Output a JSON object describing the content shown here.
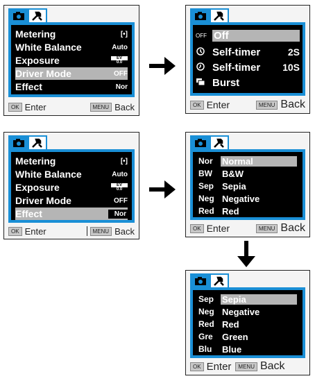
{
  "panel1": {
    "rows": [
      {
        "label": "Metering",
        "value": "[•]"
      },
      {
        "label": "White Balance",
        "value": "Auto"
      },
      {
        "label": "Exposure",
        "value_top": "EV",
        "value_bottom": "0.0"
      },
      {
        "label": "Driver Mode",
        "value": "OFF"
      },
      {
        "label": "Effect",
        "value": "Nor"
      }
    ],
    "footer": {
      "enter_key": "OK",
      "enter_label": "Enter",
      "back_key": "MENU",
      "back_label": "Back"
    }
  },
  "panel2": {
    "rows": [
      {
        "icon": "OFF",
        "label": "Off",
        "value": ""
      },
      {
        "icon": "timer-2s-icon",
        "label": "Self-timer",
        "value": "2S"
      },
      {
        "icon": "timer-10s-icon",
        "label": "Self-timer",
        "value": "10S"
      },
      {
        "icon": "burst-icon",
        "label": "Burst",
        "value": ""
      }
    ],
    "footer": {
      "enter_key": "OK",
      "enter_label": "Enter",
      "back_key": "MENU",
      "back_label": "Back"
    }
  },
  "panel3": {
    "rows": [
      {
        "label": "Metering",
        "value": "[•]"
      },
      {
        "label": "White Balance",
        "value": "Auto"
      },
      {
        "label": "Exposure",
        "value_top": "EV",
        "value_bottom": "0.0"
      },
      {
        "label": "Driver Mode",
        "value": "OFF"
      },
      {
        "label": "Effect",
        "value": "Nor"
      }
    ],
    "footer": {
      "enter_key": "OK",
      "enter_label": "Enter",
      "back_key": "MENU",
      "back_label": "Back"
    }
  },
  "panel4": {
    "rows": [
      {
        "code": "Nor",
        "name": "Normal"
      },
      {
        "code": "BW",
        "name": "B&W"
      },
      {
        "code": "Sep",
        "name": "Sepia"
      },
      {
        "code": "Neg",
        "name": "Negative"
      },
      {
        "code": "Red",
        "name": "Red"
      }
    ],
    "footer": {
      "enter_key": "OK",
      "enter_label": "Enter",
      "back_key": "MENU",
      "back_label": "Back"
    }
  },
  "panel5": {
    "rows": [
      {
        "code": "Sep",
        "name": "Sepia"
      },
      {
        "code": "Neg",
        "name": "Negative"
      },
      {
        "code": "Red",
        "name": "Red"
      },
      {
        "code": "Gre",
        "name": "Green"
      },
      {
        "code": "Blu",
        "name": "Blue"
      }
    ],
    "footer": {
      "enter_key": "OK",
      "enter_label": "Enter",
      "back_key": "MENU",
      "back_label": "Back"
    }
  },
  "colors": {
    "accent": "#1a8fd6",
    "screen": "#000000",
    "highlight": "#b5b5b5"
  }
}
